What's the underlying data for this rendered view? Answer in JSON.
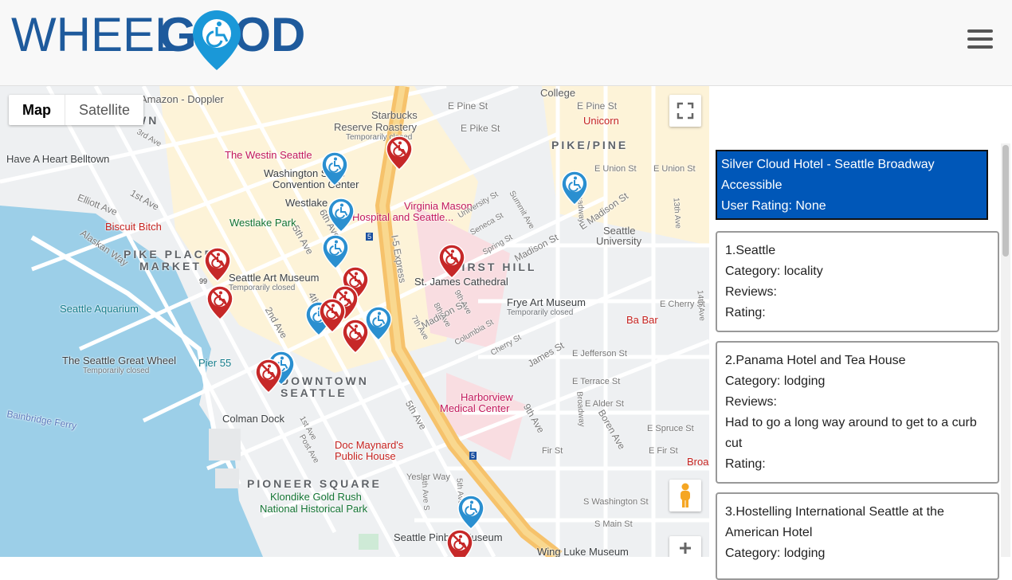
{
  "brand": {
    "logo_left": "WHEEL",
    "logo_right": "GOOD",
    "primary_color": "#1e5a9c",
    "accent_color": "#1a98d8"
  },
  "header": {
    "menu_icon": "hamburger-menu-icon"
  },
  "map": {
    "type_controls": {
      "map_label": "Map",
      "satellite_label": "Satellite"
    },
    "labels": {
      "amazon": "Amazon - Doppler",
      "college": "College",
      "e_pine": "E Pine St",
      "e_pine2": "E Pine St",
      "starbucks": "Starbucks",
      "reserve": "Reserve Roastery",
      "temp_closed1": "Temporarily closed",
      "e_pike": "E Pike St",
      "unicorn": "Unicorn",
      "pike_pine": "PIKE/PINE",
      "westin": "The Westin Seattle",
      "belltown": "Have A Heart Belltown",
      "washington": "Washington State",
      "convention": "Convention Center",
      "westlake": "Westlake",
      "e_union": "E Union St",
      "e_union2": "E Union St",
      "virginia": "Virginia Mason",
      "hospital": "Hospital and Seattle...",
      "westlake_park": "Westlake Park",
      "biscuit": "Biscuit Bitch",
      "seattle_u1": "Seattle",
      "seattle_u2": "University",
      "pike_place1": "PIKE PLACE",
      "pike_place2": "MARKET",
      "first_hill": "FIRST HILL",
      "sam": "Seattle Art Museum",
      "temp_closed2": "Temporarily closed",
      "st_james": "St. James Cathedral",
      "aquarium": "Seattle Aquarium",
      "frye": "Frye Art Museum",
      "temp_closed3": "Temporarily closed",
      "e_cherry": "E Cherry St",
      "babar": "Ba Bar",
      "great_wheel": "The Seattle Great Wheel",
      "temp_closed4": "Temporarily closed",
      "pier55": "Pier 55",
      "e_jefferson": "E Jefferson St",
      "downtown1": "DOWNTOWN",
      "downtown2": "SEATTLE",
      "e_terrace": "E Terrace St",
      "harborview1": "Harborview",
      "harborview2": "Medical Center",
      "e_alder": "E Alder St",
      "bainbridge": "Bainbridge Ferry",
      "colman": "Colman Dock",
      "e_spruce": "E Spruce St",
      "fir": "Fir St",
      "e_fir": "E Fir St",
      "doc1": "Doc Maynard's",
      "doc2": "Public House",
      "broa": "Broa",
      "yesler": "Yesler Way",
      "pioneer": "PIONEER SQUARE",
      "klondike1": "Klondike Gold Rush",
      "klondike2": "National Historical Park",
      "s_washington": "S Washington St",
      "s_main": "S Main St",
      "pinball": "Seattle Pinball Museum",
      "wing_luke": "Wing Luke Museum",
      "first_ave": "1st Ave",
      "elliott": "Elliott Ave",
      "alaskan": "Alaskan Way",
      "third_ave": "3rd Ave",
      "fifth_ave": "5th Ave",
      "sixth_ave": "6th Ave",
      "fourth_ave": "4th Ave",
      "second_ave": "2nd Ave",
      "i5exp": "I-5 Express",
      "madison": "Madison St",
      "madison2": "Madison St",
      "e_madison": "E Madison St",
      "broadway": "Broadway",
      "broadway2": "Broadway",
      "university": "University St",
      "seneca": "Seneca St",
      "spring": "Spring St",
      "summit": "Summit Ave",
      "columbia": "Columbia St",
      "cherry": "Cherry St",
      "james": "James St",
      "fifth_ave_s": "5th Ave",
      "ninth_ave": "9th Ave",
      "boren": "Boren Ave",
      "fourth_ave_s": "4th Ave S",
      "fifth_ave_s2": "5th Ave S",
      "first_ave_s": "1st Ave",
      "post_ave": "Post Ave",
      "thirteenth": "13th Ave",
      "fourteenth": "14th Ave",
      "seventh": "7th Ave",
      "eighth": "8th Ave",
      "ninth2": "9th Ave",
      "w_n": "WN",
      "hwy99": "99",
      "i5a": "5",
      "i5b": "5"
    }
  },
  "sidebar": {
    "selected": {
      "name": "Silver Cloud Hotel - Seattle Broadway",
      "status": "Accessible",
      "rating": "User Rating: None"
    },
    "results": [
      {
        "title": "1.Seattle",
        "category": "Category: locality",
        "reviews": "Reviews:",
        "review_text": "",
        "rating": "Rating:"
      },
      {
        "title": "2.Panama Hotel and Tea House",
        "category": "Category: lodging",
        "reviews": "Reviews:",
        "review_text": "Had to go a long way around to get to a curb cut",
        "rating": "Rating:"
      },
      {
        "title": "3.Hostelling International Seattle at the American Hotel",
        "category": "Category: lodging"
      }
    ]
  },
  "pins": [
    {
      "kind": "accessible"
    },
    {
      "kind": "accessible"
    },
    {
      "kind": "accessible"
    },
    {
      "kind": "accessible"
    },
    {
      "kind": "accessible"
    },
    {
      "kind": "accessible"
    },
    {
      "kind": "accessible"
    },
    {
      "kind": "accessible"
    },
    {
      "kind": "inaccessible"
    },
    {
      "kind": "inaccessible"
    },
    {
      "kind": "inaccessible"
    },
    {
      "kind": "inaccessible"
    },
    {
      "kind": "inaccessible"
    },
    {
      "kind": "inaccessible"
    },
    {
      "kind": "inaccessible"
    },
    {
      "kind": "inaccessible"
    },
    {
      "kind": "inaccessible"
    },
    {
      "kind": "inaccessible"
    },
    {
      "kind": "inaccessible"
    }
  ]
}
